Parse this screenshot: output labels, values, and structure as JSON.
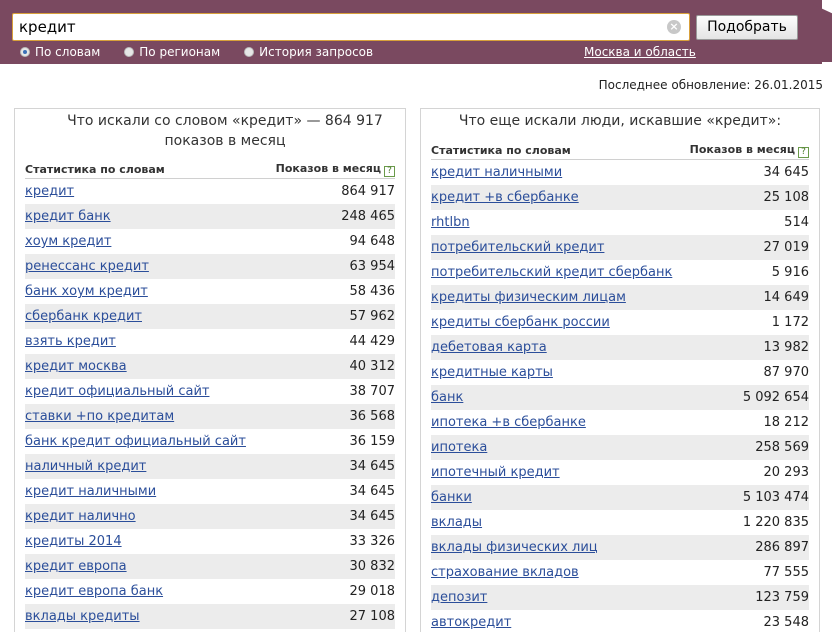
{
  "search": {
    "value": "кредит",
    "submit_label": "Подобрать",
    "clear_glyph": "×"
  },
  "modes": [
    {
      "label": "По словам",
      "checked": true
    },
    {
      "label": "По регионам",
      "checked": false
    },
    {
      "label": "История запросов",
      "checked": false
    }
  ],
  "region_label": "Москва и область",
  "updated_text": "Последнее обновление: 26.01.2015",
  "left_panel": {
    "title": "Что искали со словом «кредит» — 864 917 показов в месяц",
    "col_keyword": "Статистика по словам",
    "col_count": "Показов в месяц",
    "rows": [
      {
        "kw": "кредит",
        "cnt": "864 917"
      },
      {
        "kw": "кредит банк",
        "cnt": "248 465"
      },
      {
        "kw": "хоум кредит",
        "cnt": "94 648"
      },
      {
        "kw": "ренессанс кредит",
        "cnt": "63 954"
      },
      {
        "kw": "банк хоум кредит",
        "cnt": "58 436"
      },
      {
        "kw": "сбербанк кредит",
        "cnt": "57 962"
      },
      {
        "kw": "взять кредит",
        "cnt": "44 429"
      },
      {
        "kw": "кредит москва",
        "cnt": "40 312"
      },
      {
        "kw": "кредит официальный сайт",
        "cnt": "38 707"
      },
      {
        "kw": "ставки +по кредитам",
        "cnt": "36 568"
      },
      {
        "kw": "банк кредит официальный сайт",
        "cnt": "36 159"
      },
      {
        "kw": "наличный кредит",
        "cnt": "34 645"
      },
      {
        "kw": "кредит наличными",
        "cnt": "34 645"
      },
      {
        "kw": "кредит налично",
        "cnt": "34 645"
      },
      {
        "kw": "кредиты 2014",
        "cnt": "33 326"
      },
      {
        "kw": "кредит европа",
        "cnt": "30 832"
      },
      {
        "kw": "кредит европа банк",
        "cnt": "29 018"
      },
      {
        "kw": "вклады кредиты",
        "cnt": "27 108"
      }
    ]
  },
  "right_panel": {
    "title": "Что еще искали люди, искавшие «кредит»:",
    "col_keyword": "Статистика по словам",
    "col_count": "Показов в месяц",
    "rows": [
      {
        "kw": "кредит наличными",
        "cnt": "34 645"
      },
      {
        "kw": "кредит +в сбербанке",
        "cnt": "25 108"
      },
      {
        "kw": "rhtlbn",
        "cnt": "514"
      },
      {
        "kw": "потребительский кредит",
        "cnt": "27 019"
      },
      {
        "kw": "потребительский кредит сбербанк",
        "cnt": "5 916"
      },
      {
        "kw": "кредиты физическим лицам",
        "cnt": "14 649"
      },
      {
        "kw": "кредиты сбербанк россии",
        "cnt": "1 172"
      },
      {
        "kw": "дебетовая карта",
        "cnt": "13 982"
      },
      {
        "kw": "кредитные карты",
        "cnt": "87 970"
      },
      {
        "kw": "банк",
        "cnt": "5 092 654"
      },
      {
        "kw": "ипотека +в сбербанке",
        "cnt": "18 212"
      },
      {
        "kw": "ипотека",
        "cnt": "258 569"
      },
      {
        "kw": "ипотечный кредит",
        "cnt": "20 293"
      },
      {
        "kw": "банки",
        "cnt": "5 103 474"
      },
      {
        "kw": "вклады",
        "cnt": "1 220 835"
      },
      {
        "kw": "вклады физических лиц",
        "cnt": "286 897"
      },
      {
        "kw": "страхование вкладов",
        "cnt": "77 555"
      },
      {
        "kw": "депозит",
        "cnt": "123 759"
      },
      {
        "kw": "автокредит",
        "cnt": "23 548"
      }
    ]
  },
  "colors": {
    "header_bg": "#7a4960",
    "link": "#2b4e9a",
    "row_stripe": "#ececec"
  }
}
